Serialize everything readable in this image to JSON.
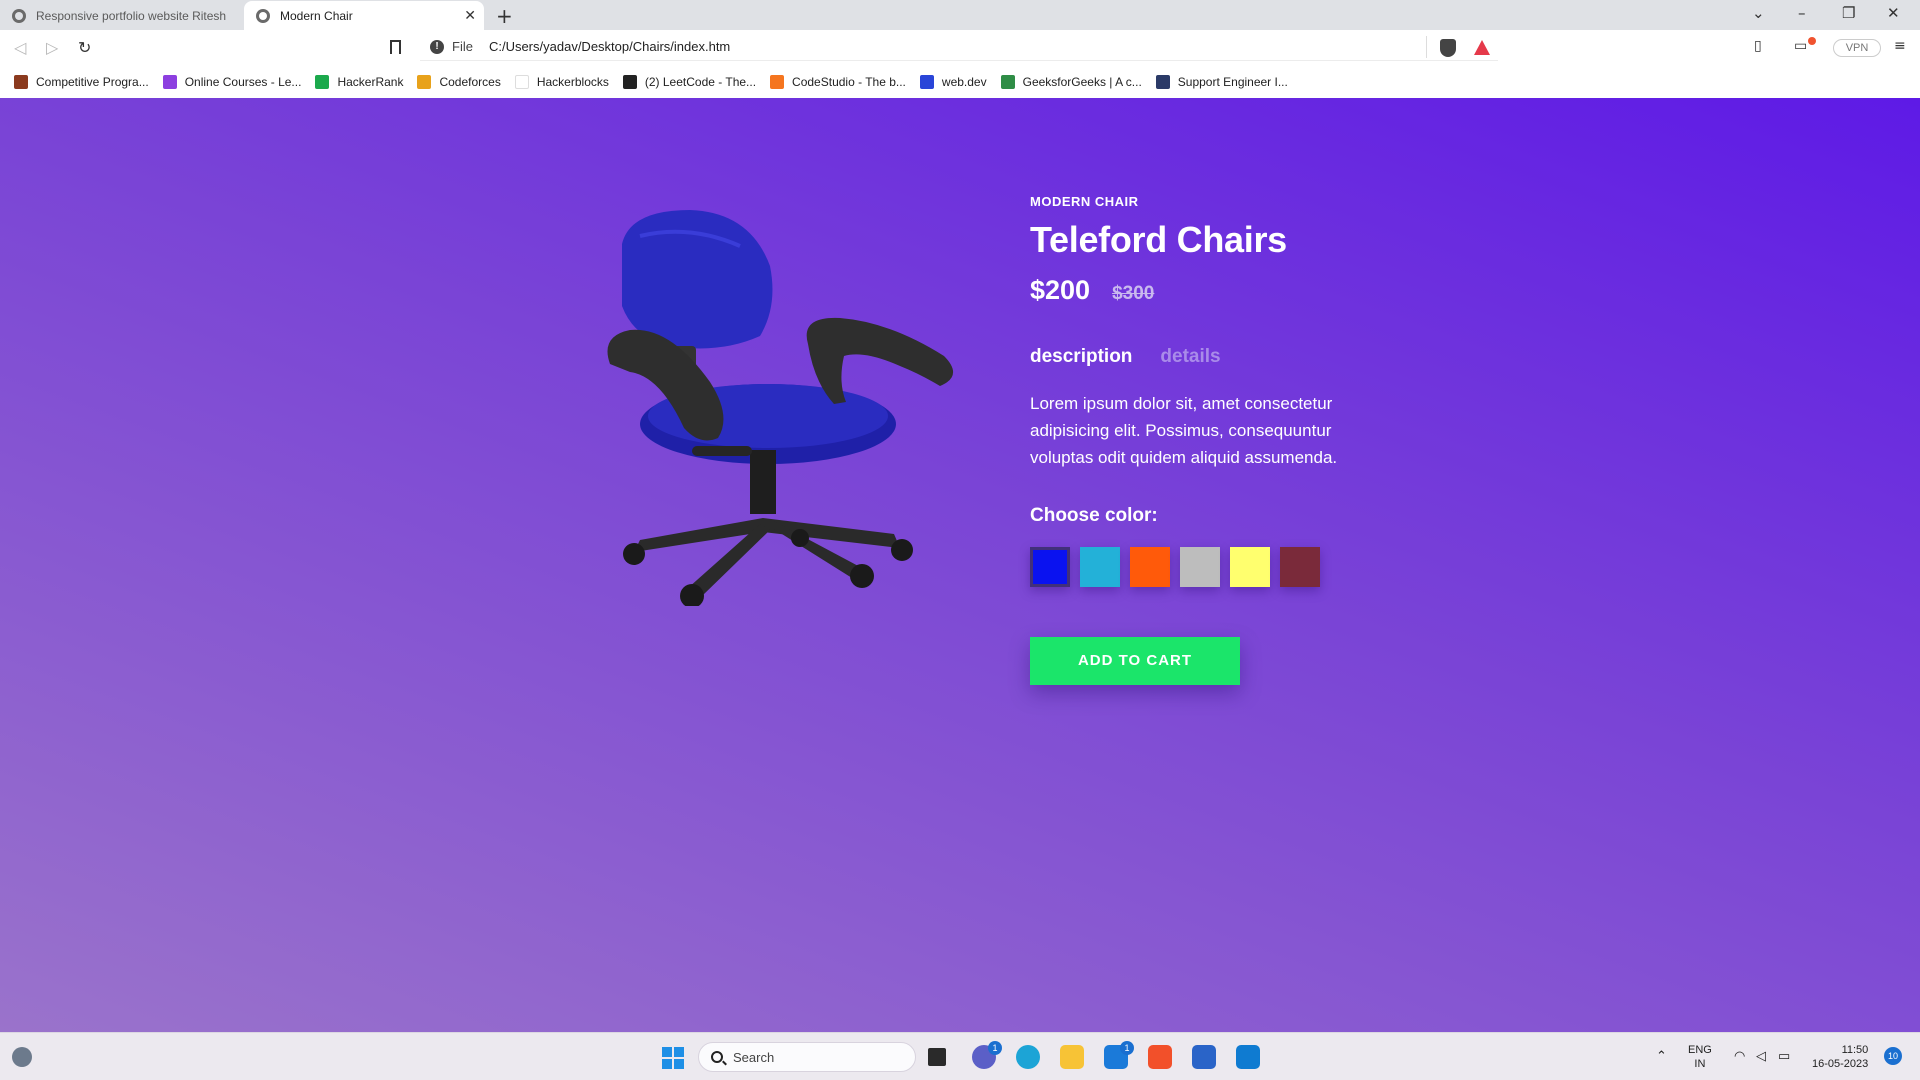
{
  "browser": {
    "tabs": [
      {
        "title": "Responsive portfolio website Ritesh"
      },
      {
        "title": "Modern Chair"
      }
    ],
    "new_tab": "+",
    "close_tab": "✕",
    "omnibox": {
      "scheme_label": "File",
      "url": "C:/Users/yadav/Desktop/Chairs/index.htm"
    },
    "vpn_label": "VPN",
    "bookmarks": [
      {
        "label": "Competitive Progra...",
        "color": "#8b3a1e"
      },
      {
        "label": "Online Courses - Le...",
        "color": "#8d3fe0"
      },
      {
        "label": "HackerRank",
        "color": "#1ba94c"
      },
      {
        "label": "Codeforces",
        "color": "#e8a21b"
      },
      {
        "label": "Hackerblocks",
        "color": "#ffffff"
      },
      {
        "label": "(2) LeetCode - The...",
        "color": "#222222"
      },
      {
        "label": "CodeStudio - The b...",
        "color": "#f5751f"
      },
      {
        "label": "web.dev",
        "color": "#2a45d8"
      },
      {
        "label": "GeeksforGeeks | A c...",
        "color": "#2f8d46"
      },
      {
        "label": "Support Engineer I...",
        "color": "#2b3a67"
      }
    ]
  },
  "product": {
    "eyebrow": "MODERN CHAIR",
    "title": "Teleford Chairs",
    "price": "$200",
    "old_price": "$300",
    "tabs": [
      "description",
      "details"
    ],
    "description": "Lorem ipsum dolor sit, amet consectetur adipisicing elit. Possimus, consequuntur voluptas odit quidem aliquid assumenda.",
    "choose_color_label": "Choose color:",
    "colors": [
      "#0a12f0",
      "#23b1d8",
      "#ff5a0a",
      "#bdbdbd",
      "#ffff6e",
      "#7a2a3a"
    ],
    "selected_color_index": 0,
    "add_to_cart": "ADD TO CART"
  },
  "taskbar": {
    "search_placeholder": "Search",
    "teams_badge": "1",
    "mail_badge": "1",
    "language": "ENG",
    "region": "IN",
    "time": "11:50",
    "date": "16-05-2023",
    "notifications": "10"
  }
}
